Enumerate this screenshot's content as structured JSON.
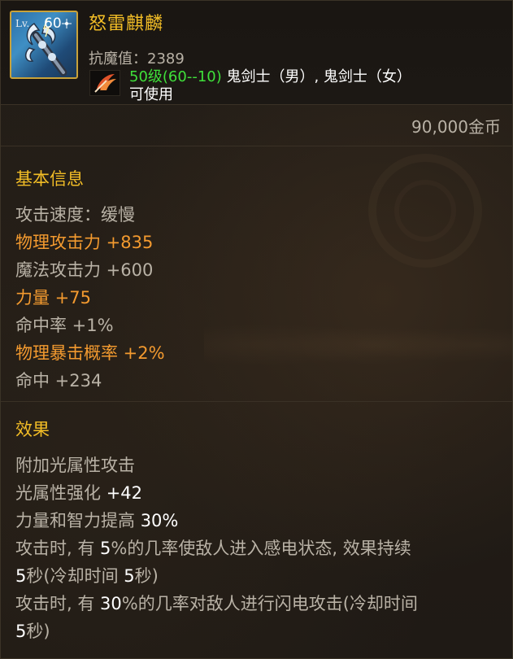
{
  "item": {
    "level_label": "Lv.",
    "level": "60",
    "name": "怒雷麒麟",
    "anti_magic": "抗魔值：2389",
    "requirement_level": "50级(60--10)",
    "requirement_classes": " 鬼剑士（男）, 鬼剑士（女）",
    "usable": "可使用",
    "price": "90,000金币",
    "icon": "lightning-staff-icon",
    "class_icon": "slayer-class-icon"
  },
  "basic": {
    "title": "基本信息",
    "lines": [
      {
        "text": "攻击速度：缓慢",
        "color": "#b9b2a6"
      },
      {
        "text": "物理攻击力 +835",
        "color": "#f39a2f"
      },
      {
        "text": "魔法攻击力 +600",
        "color": "#b9b2a6"
      },
      {
        "text": "力量 +75",
        "color": "#f39a2f"
      },
      {
        "text": "命中率 +1%",
        "color": "#b9b2a6"
      },
      {
        "text": "物理暴击概率 +2%",
        "color": "#f39a2f"
      },
      {
        "text": "命中 +234",
        "color": "#b9b2a6"
      }
    ]
  },
  "effects": {
    "title": "效果",
    "lines": [
      {
        "plain_prefix": "附加光属性攻击"
      },
      {
        "plain_prefix": "光属性强化 ",
        "highlight": "+42"
      },
      {
        "plain_prefix": "力量和智力提高 ",
        "highlight": "30%"
      },
      {
        "plain_prefix": "攻击时, 有 ",
        "highlight": "5",
        "plain_suffix": "%的几率使敌人进入感电状态, 效果持续"
      },
      {
        "highlight": "5",
        "plain_suffix": "秒(冷却时间 ",
        "highlight2": "5",
        "plain_suffix2": "秒)"
      },
      {
        "plain_prefix": "攻击时, 有 ",
        "highlight": "30",
        "plain_suffix": "%的几率对敌人进行闪电攻击(冷却时间"
      },
      {
        "highlight": "5",
        "plain_suffix": "秒)"
      }
    ]
  },
  "colors": {
    "name": "#f2bd26",
    "section": "#f2bd26",
    "orange_stat": "#f39a2f",
    "grey_text": "#b9b2a6",
    "green_level": "#3fe03a",
    "icon_border": "#c9a239"
  }
}
